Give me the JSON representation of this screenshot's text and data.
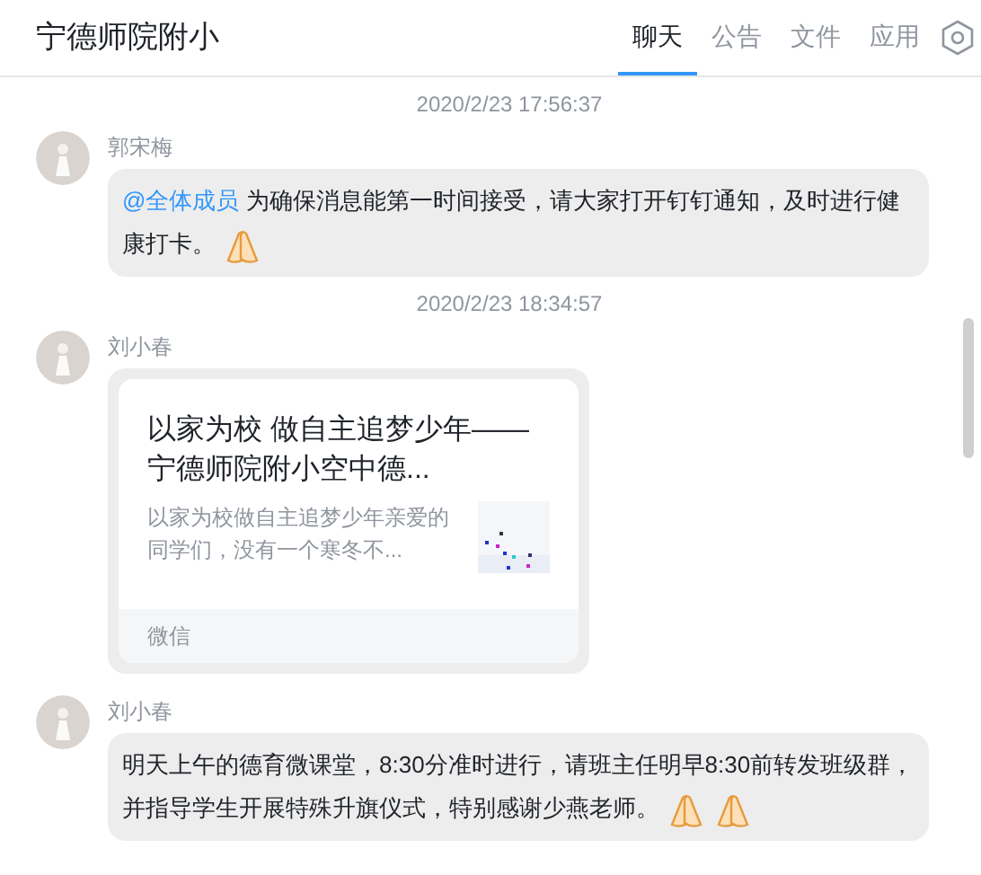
{
  "header": {
    "title": "宁德师院附小",
    "tabs": [
      {
        "label": "聊天",
        "selected": true
      },
      {
        "label": "公告",
        "selected": false
      },
      {
        "label": "文件",
        "selected": false
      },
      {
        "label": "应用",
        "selected": false
      }
    ]
  },
  "messages": [
    {
      "kind": "text",
      "timestamp": "2020/2/23 17:56:37",
      "sender": "郭宋梅",
      "mention": "@全体成员",
      "text": "为确保消息能第一时间接受，请大家打开钉钉通知，及时进行健康打卡。",
      "emojis": [
        {
          "kind": "folded-hands"
        }
      ]
    },
    {
      "kind": "link",
      "timestamp": "2020/2/23 18:34:57",
      "sender": "刘小春",
      "title": "以家为校  做自主追梦少年——宁德师院附小空中德...",
      "summary": "以家为校做自主追梦少年亲爱的同学们，没有一个寒冬不...",
      "source": "微信"
    },
    {
      "kind": "text",
      "sender": "刘小春",
      "text": "明天上午的德育微课堂，8:30分准时进行，请班主任明早8:30前转发班级群，并指导学生开展特殊升旗仪式，特别感谢少燕老师。",
      "emojis": [
        {
          "kind": "folded-hands"
        },
        {
          "kind": "folded-hands"
        }
      ]
    }
  ]
}
